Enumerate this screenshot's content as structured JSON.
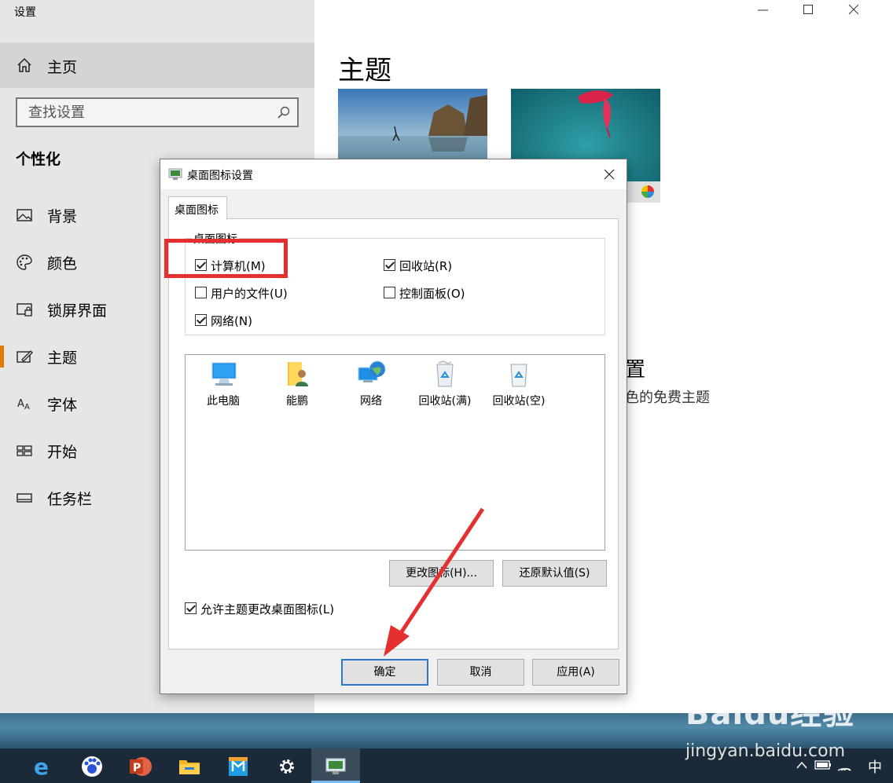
{
  "settings": {
    "app_title": "设置",
    "home_label": "主页",
    "search_placeholder": "查找设置",
    "section_title": "个性化",
    "nav_items": [
      {
        "label": "背景",
        "icon": "image-icon"
      },
      {
        "label": "颜色",
        "icon": "palette-icon"
      },
      {
        "label": "锁屏界面",
        "icon": "lock-screen-icon"
      },
      {
        "label": "主题",
        "icon": "theme-brush-icon"
      },
      {
        "label": "字体",
        "icon": "font-icon"
      },
      {
        "label": "开始",
        "icon": "start-grid-icon"
      },
      {
        "label": "任务栏",
        "icon": "taskbar-icon"
      }
    ],
    "active_nav": "主题",
    "accent_color": "#e07a00"
  },
  "main": {
    "title": "主题",
    "heading_partial": "置",
    "sub_partial": "色的免费主题"
  },
  "dialog": {
    "title": "桌面图标设置",
    "tab_label": "桌面图标",
    "group_label": "桌面图标",
    "checkboxes": [
      {
        "label": "计算机(M)",
        "checked": true
      },
      {
        "label": "回收站(R)",
        "checked": true
      },
      {
        "label": "用户的文件(U)",
        "checked": false
      },
      {
        "label": "控制面板(O)",
        "checked": false
      },
      {
        "label": "网络(N)",
        "checked": true
      }
    ],
    "icons": [
      {
        "label": "此电脑",
        "icon": "monitor-icon"
      },
      {
        "label": "能鹏",
        "icon": "user-folder-icon"
      },
      {
        "label": "网络",
        "icon": "network-globe-icon"
      },
      {
        "label": "回收站(满)",
        "icon": "recycle-bin-full-icon"
      },
      {
        "label": "回收站(空)",
        "icon": "recycle-bin-empty-icon"
      }
    ],
    "change_icon_button": "更改图标(H)...",
    "restore_default_button": "还原默认值(S)",
    "allow_theme_checkbox": {
      "label": "允许主题更改桌面图标(L)",
      "checked": true
    },
    "ok_button": "确定",
    "cancel_button": "取消",
    "apply_button": "应用(A)"
  },
  "taskbar": {
    "apps": [
      "edge-icon",
      "baidu-paw-icon",
      "powerpoint-icon",
      "file-explorer-icon",
      "store-icon",
      "settings-gear-icon",
      "desktop-icon-settings-icon"
    ],
    "ime": "中"
  },
  "watermark": {
    "logo": "Baidu经验",
    "url": "jingyan.baidu.com"
  },
  "annotation_color": "#e53030"
}
